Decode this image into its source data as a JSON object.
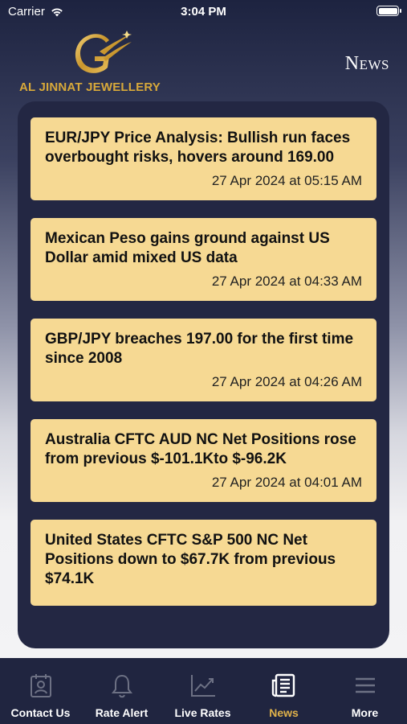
{
  "status_bar": {
    "carrier": "Carrier",
    "time": "3:04 PM"
  },
  "brand": {
    "name": "AL JINNAT JEWELLERY",
    "logo_letter": "G"
  },
  "header": {
    "title": "News"
  },
  "news": [
    {
      "title": "EUR/JPY Price Analysis: Bullish run faces overbought risks, hovers around 169.00",
      "date": "27 Apr 2024 at 05:15 AM"
    },
    {
      "title": "Mexican Peso gains ground against US Dollar amid mixed US data",
      "date": "27 Apr 2024 at 04:33 AM"
    },
    {
      "title": "GBP/JPY breaches 197.00 for the first time since 2008",
      "date": "27 Apr 2024 at 04:26 AM"
    },
    {
      "title": "Australia CFTC AUD NC Net Positions rose from previous $-101.1Kto $-96.2K",
      "date": "27 Apr 2024 at 04:01 AM"
    },
    {
      "title": "United States CFTC S&P 500 NC Net Positions down to $67.7K from previous $74.1K",
      "date": ""
    }
  ],
  "tabs": [
    {
      "label": "Contact Us",
      "icon": "contact-icon",
      "active": false
    },
    {
      "label": "Rate Alert",
      "icon": "bell-icon",
      "active": false
    },
    {
      "label": "Live Rates",
      "icon": "chart-icon",
      "active": false
    },
    {
      "label": "News",
      "icon": "news-icon",
      "active": true
    },
    {
      "label": "More",
      "icon": "menu-icon",
      "active": false
    }
  ],
  "colors": {
    "accent": "#e0b24a",
    "card": "#f6d993",
    "panel": "#232743",
    "tabbar": "#202540",
    "brand_gold": "#d7a83a"
  }
}
